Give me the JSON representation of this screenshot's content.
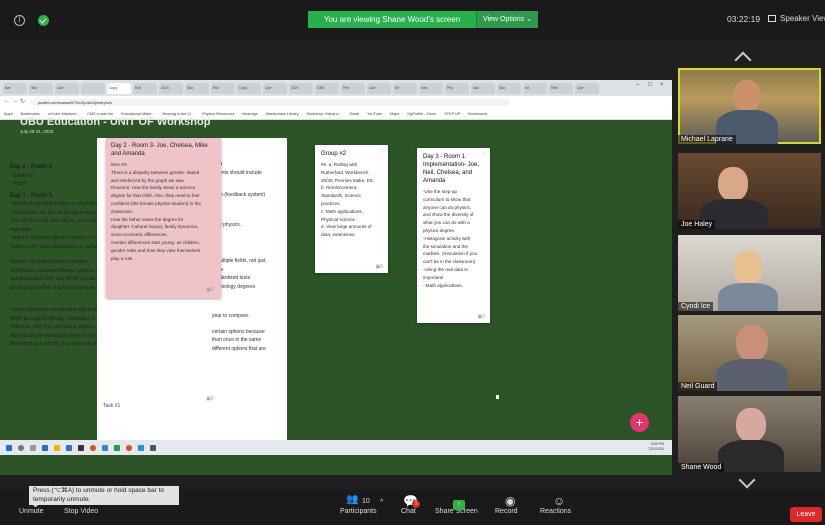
{
  "topbar": {
    "viewing_banner": "You are viewing Shane Wood's screen",
    "view_options": "View Options ⌄",
    "clock": "03:22:19",
    "speaker_view": "Speaker View"
  },
  "browser": {
    "tabs": [
      "Bar",
      "Stor",
      "Carl",
      "",
      "Copy",
      "Roll",
      "2020",
      "Stor",
      "Roll",
      "Copy",
      "Que",
      "2021",
      "GRA",
      "Peri",
      "Carl",
      "Elf",
      "Inbx",
      "Phy",
      "Mal",
      "Stor",
      "Inf",
      "Rete",
      "Que"
    ],
    "url": "padlet.com/wansol575/c2pxsl2ejhmby5eo",
    "bookmarks": [
      "Apps",
      "Bookmarks",
      "ccCube Mastercl...",
      "CMS a cast me",
      "Educational Mater...",
      "Nearing in the Cl...",
      "Physics Resources",
      "Nearings",
      "Masterclass Library",
      "Workshop Virtual a...",
      "Email",
      "YouTube",
      "Maps",
      "MyProfile - Zoom",
      "STEP UP",
      "Bookmarks"
    ]
  },
  "padlet": {
    "title": "UBU Education - UNIT OF Workshop",
    "date": "July 29-31, 2020"
  },
  "left_text": {
    "room2_header": "Day 2 - Room 2",
    "room2_lines": [
      "* Evidence",
      "* Rubric"
    ],
    "room3_header": "Day 1 - Room 3",
    "room3_lines": [
      "*Identify things that makes us uncomfortable",
      "* Sometimes we feel as though everyone else is",
      "*Do not try to talk over others, you could",
      "important",
      "*Actions can have different impact on others",
      "\"taking over\" class discussions or actions"
    ],
    "careers_lines": [
      "Number of medical related careers",
      "Significant crossover between physics a",
      "Surprised that LSAT and MCAT scores ar",
      "Surprising number of jobs involving art a"
    ],
    "discussion_lines": [
      "Career discussion would work well at beginning of the year.",
      "Might be a good first day icebreaker or way to get students talking about themselves",
      "(interests, why they are taking physics, etc.)",
      "Have students investigate careers and present findings to the class.",
      "More than one activity, or a research project, would require more than one day."
    ]
  },
  "mid_text": {
    "header": "nda",
    "lines": [
      "tudents should include",
      "",
      "",
      "stem (feedback system)",
      "",
      "",
      "",
      "note physics.",
      "",
      "",
      "",
      "",
      "n multiple fields, not just",
      "ctors",
      "tandardized tests",
      "ian biology degrees",
      "",
      "",
      "",
      "year to compare.",
      "",
      "certain options because",
      "than once in the same",
      "different options that are"
    ]
  },
  "pink_card": {
    "title": "Day 2 - Room 3- Joe, Chelsea, Mike and Amanda",
    "body": [
      "Item #4-",
      "There is a disparity between gender- stated",
      "and reinforced by the graph we saw",
      "Reasons: How the family views a science",
      "degree for that child. Also, they need to feel",
      "confident (the female physics student) in the",
      "classroom.",
      "How the father views the degree for",
      "daughter. Cultural impact, family dynamics,",
      "socio-economic differences.",
      "Gender differences start young: as children,",
      "gender roles and how they view themselves",
      "play a role."
    ],
    "comments": "0"
  },
  "group_card": {
    "title": "Group #2",
    "body": [
      "#5. a. Rolling with",
      "Rutherford, Workbench",
      "26/30, Pennies Make, Etc.",
      "b. Reinforcement,",
      "Standards, Science",
      "practices.",
      "c. Math applications,",
      "Physical science",
      "d. View large amounts of",
      "data, extensions."
    ],
    "comments": "0"
  },
  "day3_card": {
    "title": "Day 3 - Room 1 Implementation- Joe, Neil, Chelsea, and Amanda",
    "body": [
      "-Use the step-up",
      "curriculum to show that",
      "anyone can do physics,",
      "and show the diversity of",
      "what you can do with a",
      "physics degree.",
      "-Histogram activity with",
      "the simulation and the",
      "marbles. (Simulation if you",
      "can't be in the classroom)",
      "-Using the real data is",
      "important!",
      "- Math applications."
    ],
    "comments": "0"
  },
  "task_label": "Task #1",
  "big_card_comments": "0",
  "fab_label": "+",
  "taskbar_time": [
    "3:09 PM",
    "7/31/2020"
  ],
  "participants": [
    {
      "name": "Michael Laprarie",
      "active": true
    },
    {
      "name": "Joe Haley",
      "active": false
    },
    {
      "name": "Cyndi Ice",
      "active": false
    },
    {
      "name": "Neil Guard",
      "active": false
    },
    {
      "name": "Shane Wood",
      "active": false
    }
  ],
  "toolbar": {
    "tooltip": "Press (⌥⌘A) to unmute or hold space bar to temporarily unmute.",
    "unmute": "Unmute",
    "stop_video": "Stop Video",
    "participants_label": "Participants",
    "participants_count": "10",
    "chat": "Chat",
    "chat_badge": "1",
    "share_screen": "Share Screen",
    "record": "Record",
    "reactions": "Reactions",
    "leave": "Leave"
  },
  "colors": {
    "accent_green": "#26b14d",
    "padlet_bg": "#2c5427",
    "pink_card": "#efc4c9",
    "leave_red": "#e02828",
    "fab_pink": "#e8326f",
    "active_speaker": "#d8d820"
  }
}
